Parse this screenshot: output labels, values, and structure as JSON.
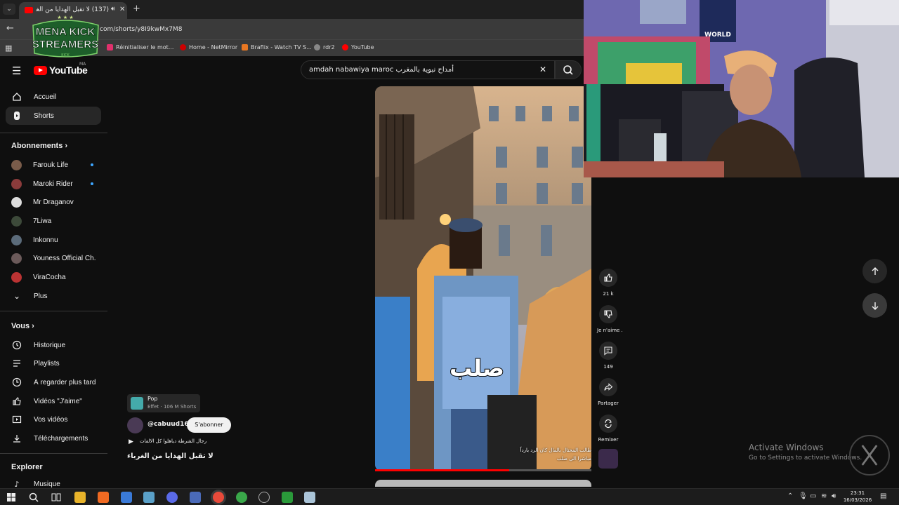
{
  "browser": {
    "tab_title": "(137) لا تقبل الهدايا من الغرباء",
    "url": "com/shorts/y8I9kwMx7M8",
    "bookmarks": [
      {
        "label": "Réinitialiser le mot...",
        "color": "#e1306c"
      },
      {
        "label": "Home - NetMirror",
        "color": "#c00"
      },
      {
        "label": "Braflix - Watch TV S...",
        "color": "#e87722"
      },
      {
        "label": "rdr2",
        "color": "#888"
      },
      {
        "label": "YouTube",
        "color": "#ff0000"
      }
    ]
  },
  "stream_logo": {
    "line1": "MENA KICK",
    "line2": "STREAMERS",
    "line3": "KICK"
  },
  "youtube": {
    "logo_text": "YouTube",
    "country": "MA",
    "search_query": "amdah nabawiya maroc أمداح نبوية بالمغرب"
  },
  "sidebar": {
    "main": [
      {
        "label": "Accueil",
        "icon": "home-icon"
      },
      {
        "label": "Shorts",
        "icon": "shorts-icon",
        "active": true
      }
    ],
    "subscriptions_title": "Abonnements",
    "subscriptions": [
      {
        "label": "Farouk Life",
        "color": "#7a5c4a",
        "dot": true
      },
      {
        "label": "Maroki Rider",
        "color": "#8b3b3b",
        "dot": true
      },
      {
        "label": "Mr Draganov",
        "color": "#dddddd",
        "dot": false
      },
      {
        "label": "7Liwa",
        "color": "#3d4a3a",
        "dot": false
      },
      {
        "label": "Inkonnu",
        "color": "#5b6b7a",
        "dot": false
      },
      {
        "label": "Youness Official Ch...",
        "color": "#6b5a5a",
        "dot": false
      },
      {
        "label": "ViraCocha",
        "color": "#b33",
        "dot": false
      },
      {
        "label": "Plus",
        "color": "",
        "dot": false
      }
    ],
    "you_title": "Vous",
    "you": [
      {
        "label": "Historique",
        "icon": "history-icon"
      },
      {
        "label": "Playlists",
        "icon": "playlist-icon"
      },
      {
        "label": "À regarder plus tard",
        "icon": "clock-icon"
      },
      {
        "label": "Vidéos \"J'aime\"",
        "icon": "thumb-up-icon"
      },
      {
        "label": "Vos vidéos",
        "icon": "video-icon"
      },
      {
        "label": "Téléchargements",
        "icon": "download-icon"
      }
    ],
    "explore_title": "Explorer",
    "explore": [
      {
        "label": "Musique",
        "icon": "music-icon"
      }
    ]
  },
  "short": {
    "caption": "صلب",
    "subtitle_line1": "طالب المحتال بالمال كان الرد بارداً",
    "subtitle_line2": "مباشرا الى صلب",
    "progress": 0.62,
    "effect_name": "Pop",
    "effect_meta": "Effet · 106 M Shorts",
    "channel": "@cabuud16",
    "subscribe": "S'abonner",
    "music": "رجال الشرطة دياهلوا كل الالفات",
    "title": "لا تقبل الهدايا من الغرباء"
  },
  "actions": {
    "likes": "21 k",
    "dislike": "Je n'aime .",
    "comments": "149",
    "share": "Partager",
    "remix": "Remixer"
  },
  "overlay": {
    "activate_title": "Activate Windows",
    "activate_sub": "Go to Settings to activate Windows."
  },
  "taskbar": {
    "time": "23:31",
    "date": "16/03/2026"
  }
}
